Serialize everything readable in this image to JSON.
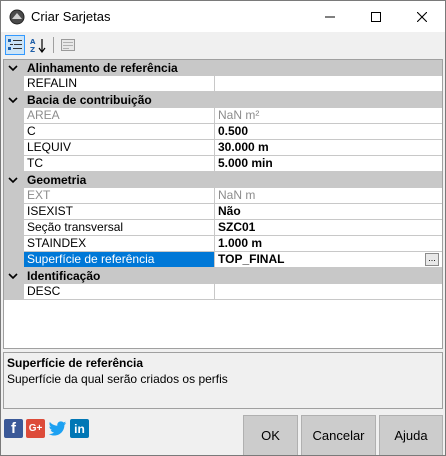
{
  "window": {
    "title": "Criar Sarjetas"
  },
  "colors": {
    "category_bg": "#c8c8c8",
    "selection": "#0078d7",
    "facebook": "#3b5998",
    "googleplus": "#dd4b39",
    "twitter": "#1da1f2",
    "linkedin": "#0077b5"
  },
  "toolbar": {
    "icons": [
      "categorized-view-icon",
      "alphabetical-sort-icon",
      "property-pages-icon"
    ]
  },
  "grid": {
    "categories": [
      {
        "label": "Alinhamento de referência",
        "props": [
          {
            "name": "REFALIN",
            "value": ""
          }
        ]
      },
      {
        "label": "Bacia de contribuição",
        "props": [
          {
            "name": "AREA",
            "value": "NaN m²"
          },
          {
            "name": "C",
            "value": "0.500"
          },
          {
            "name": "LEQUIV",
            "value": "30.000 m"
          },
          {
            "name": "TC",
            "value": "5.000 min"
          }
        ]
      },
      {
        "label": "Geometria",
        "props": [
          {
            "name": "EXT",
            "value": "NaN m"
          },
          {
            "name": "ISEXIST",
            "value": "Não"
          },
          {
            "name": "Seção transversal",
            "value": "SZC01"
          },
          {
            "name": "STAINDEX",
            "value": "1.000 m"
          },
          {
            "name": "Superfície de referência",
            "value": "TOP_FINAL",
            "button": "..."
          }
        ]
      },
      {
        "label": "Identificação",
        "props": [
          {
            "name": "DESC",
            "value": ""
          }
        ]
      }
    ]
  },
  "description": {
    "title": "Superfície de referência",
    "text": "Superfície da qual serão criados os perfis"
  },
  "social": {
    "facebook": "f",
    "googleplus": "G+",
    "linkedin": "in"
  },
  "buttons": {
    "ok": "OK",
    "cancel": "Cancelar",
    "help": "Ajuda"
  }
}
